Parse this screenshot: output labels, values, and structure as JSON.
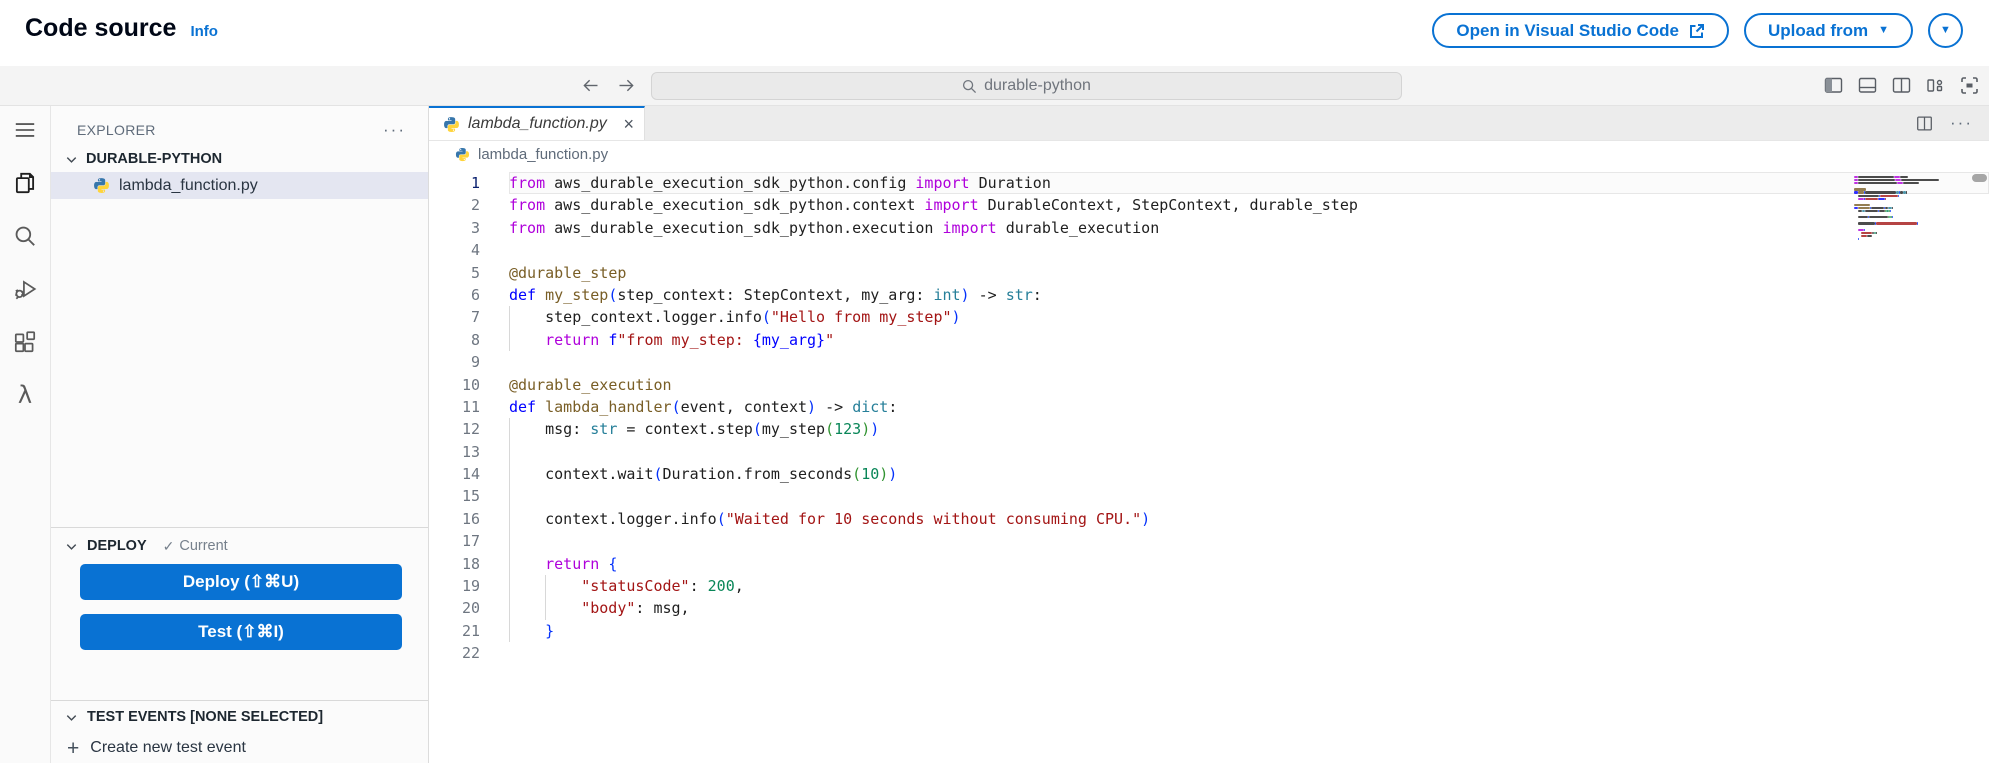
{
  "glyphs": {
    "caret_down": "▼",
    "ellipsis": "···",
    "close": "×",
    "check": "✓",
    "plus": "+"
  },
  "page_header": {
    "title": "Code source",
    "info_link": "Info",
    "open_vscode_button": "Open in Visual Studio Code",
    "upload_from_button": "Upload from"
  },
  "titlebar": {
    "search_value": "durable-python"
  },
  "activity_bar": {
    "items": [
      "menu",
      "explorer",
      "search",
      "run-debug",
      "extensions",
      "aws-lambda"
    ]
  },
  "sidebar": {
    "explorer_header": "EXPLORER",
    "folder_name": "DURABLE-PYTHON",
    "files": [
      {
        "name": "lambda_function.py",
        "selected": true
      }
    ],
    "deploy": {
      "header": "DEPLOY",
      "status": "Current",
      "deploy_button": "Deploy (⇧⌘U)",
      "test_button": "Test (⇧⌘I)"
    },
    "test_events": {
      "header": "TEST EVENTS [NONE SELECTED]",
      "create_button": "Create new test event"
    }
  },
  "editor": {
    "tab": {
      "name": "lambda_function.py"
    },
    "breadcrumb": {
      "file": "lambda_function.py"
    },
    "active_line": 1,
    "lines": [
      {
        "n": 1,
        "indent": 0,
        "tokens": [
          [
            "k",
            "from"
          ],
          [
            "p",
            " aws_durable_execution_sdk_python.config "
          ],
          [
            "k",
            "import"
          ],
          [
            "p",
            " Duration"
          ]
        ]
      },
      {
        "n": 2,
        "indent": 0,
        "tokens": [
          [
            "k",
            "from"
          ],
          [
            "p",
            " aws_durable_execution_sdk_python.context "
          ],
          [
            "k",
            "import"
          ],
          [
            "p",
            " DurableContext, StepContext, durable_step"
          ]
        ]
      },
      {
        "n": 3,
        "indent": 0,
        "tokens": [
          [
            "k",
            "from"
          ],
          [
            "p",
            " aws_durable_execution_sdk_python.execution "
          ],
          [
            "k",
            "import"
          ],
          [
            "p",
            " durable_execution"
          ]
        ]
      },
      {
        "n": 4,
        "indent": 0,
        "tokens": []
      },
      {
        "n": 5,
        "indent": 0,
        "tokens": [
          [
            "f",
            "@durable_step"
          ]
        ]
      },
      {
        "n": 6,
        "indent": 0,
        "tokens": [
          [
            "d",
            "def "
          ],
          [
            "f",
            "my_step"
          ],
          [
            "b1",
            "("
          ],
          [
            "p",
            "step_context: StepContext, my_arg: "
          ],
          [
            "t",
            "int"
          ],
          [
            "b1",
            ")"
          ],
          [
            "p",
            " -> "
          ],
          [
            "t",
            "str"
          ],
          [
            "p",
            ":"
          ]
        ]
      },
      {
        "n": 7,
        "indent": 4,
        "tokens": [
          [
            "p",
            "step_context.logger.info"
          ],
          [
            "b1",
            "("
          ],
          [
            "s",
            "\"Hello from my_step\""
          ],
          [
            "b1",
            ")"
          ]
        ]
      },
      {
        "n": 8,
        "indent": 4,
        "tokens": [
          [
            "k",
            "return "
          ],
          [
            "d",
            "f"
          ],
          [
            "s",
            "\"from my_step: "
          ],
          [
            "d",
            "{my_arg}"
          ],
          [
            "s",
            "\""
          ]
        ]
      },
      {
        "n": 9,
        "indent": 0,
        "tokens": []
      },
      {
        "n": 10,
        "indent": 0,
        "tokens": [
          [
            "f",
            "@durable_execution"
          ]
        ]
      },
      {
        "n": 11,
        "indent": 0,
        "tokens": [
          [
            "d",
            "def "
          ],
          [
            "f",
            "lambda_handler"
          ],
          [
            "b1",
            "("
          ],
          [
            "p",
            "event, context"
          ],
          [
            "b1",
            ")"
          ],
          [
            "p",
            " -> "
          ],
          [
            "t",
            "dict"
          ],
          [
            "p",
            ":"
          ]
        ]
      },
      {
        "n": 12,
        "indent": 4,
        "tokens": [
          [
            "p",
            "msg: "
          ],
          [
            "t",
            "str"
          ],
          [
            "p",
            " = context.step"
          ],
          [
            "b1",
            "("
          ],
          [
            "p",
            "my_step"
          ],
          [
            "b2",
            "("
          ],
          [
            "n",
            "123"
          ],
          [
            "b2",
            ")"
          ],
          [
            "b1",
            ")"
          ]
        ]
      },
      {
        "n": 13,
        "indent": 4,
        "tokens": []
      },
      {
        "n": 14,
        "indent": 4,
        "tokens": [
          [
            "p",
            "context.wait"
          ],
          [
            "b1",
            "("
          ],
          [
            "p",
            "Duration.from_seconds"
          ],
          [
            "b2",
            "("
          ],
          [
            "n",
            "10"
          ],
          [
            "b2",
            ")"
          ],
          [
            "b1",
            ")"
          ]
        ]
      },
      {
        "n": 15,
        "indent": 4,
        "tokens": []
      },
      {
        "n": 16,
        "indent": 4,
        "tokens": [
          [
            "p",
            "context.logger.info"
          ],
          [
            "b1",
            "("
          ],
          [
            "s",
            "\"Waited for 10 seconds without consuming CPU.\""
          ],
          [
            "b1",
            ")"
          ]
        ]
      },
      {
        "n": 17,
        "indent": 4,
        "tokens": []
      },
      {
        "n": 18,
        "indent": 4,
        "tokens": [
          [
            "k",
            "return "
          ],
          [
            "b1",
            "{"
          ]
        ]
      },
      {
        "n": 19,
        "indent": 8,
        "tokens": [
          [
            "s",
            "\"statusCode\""
          ],
          [
            "p",
            ": "
          ],
          [
            "n",
            "200"
          ],
          [
            "p",
            ","
          ]
        ]
      },
      {
        "n": 20,
        "indent": 8,
        "tokens": [
          [
            "s",
            "\"body\""
          ],
          [
            "p",
            ": msg,"
          ]
        ]
      },
      {
        "n": 21,
        "indent": 4,
        "tokens": [
          [
            "b1",
            "}"
          ]
        ]
      },
      {
        "n": 22,
        "indent": 0,
        "tokens": []
      }
    ]
  },
  "colors": {
    "accent": "#0972d3",
    "selection_bg": "#e4e6f1",
    "tab_active_border": "#0972d3",
    "tokens": {
      "k": "#af00db",
      "d": "#0000ff",
      "f": "#795e26",
      "t": "#267f99",
      "s": "#a31515",
      "n": "#098658",
      "p": "#1f1f1f",
      "b1": "#0431fa",
      "b2": "#319331"
    }
  }
}
